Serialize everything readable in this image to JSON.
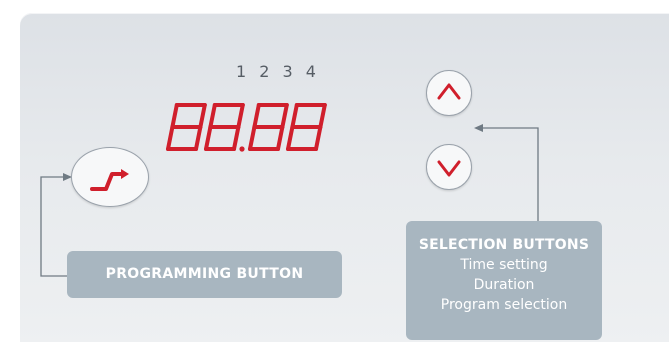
{
  "digit_indices": "1 2 3 4",
  "display": {
    "text": "88.88",
    "color": "#d01f2c"
  },
  "icons": {
    "programming": "step-arrow-icon",
    "up": "chevron-up-icon",
    "down": "chevron-down-icon"
  },
  "programming_label": "PROGRAMMING BUTTON",
  "selection_label": {
    "title": "SELECTION BUTTONS",
    "lines": [
      "Time setting",
      "Duration",
      "Program selection"
    ]
  },
  "colors": {
    "accent_red": "#d01f2c",
    "label_bg": "#a8b6c0",
    "connector": "#6f7a83"
  }
}
